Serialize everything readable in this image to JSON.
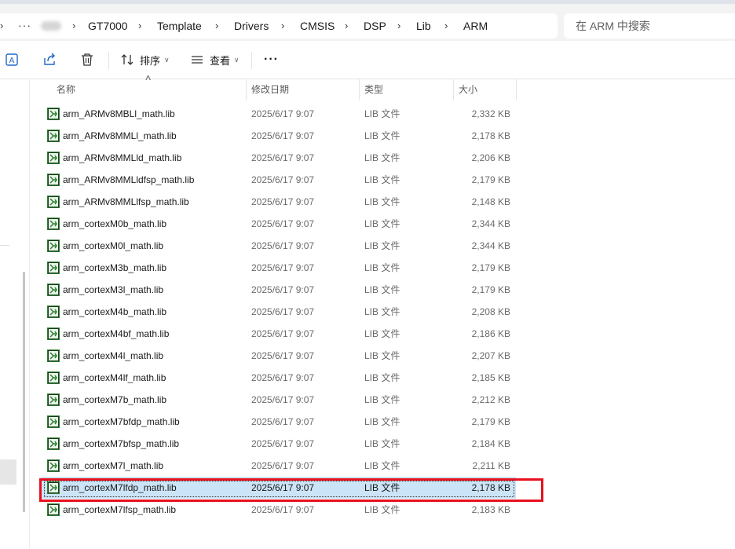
{
  "address_bar": {
    "breadcrumbs": [
      "GT7000",
      "Template",
      "Drivers",
      "CMSIS",
      "DSP",
      "Lib",
      "ARM"
    ],
    "more_label": "···",
    "search_placeholder": "在 ARM 中搜索"
  },
  "toolbar": {
    "sort_label": "排序",
    "view_label": "查看",
    "more_label": "···"
  },
  "columns": {
    "name": "名称",
    "date": "修改日期",
    "type": "类型",
    "size": "大小"
  },
  "files": [
    {
      "name": "arm_ARMv8MBLl_math.lib",
      "date": "2025/6/17 9:07",
      "type": "LIB 文件",
      "size": "2,332 KB"
    },
    {
      "name": "arm_ARMv8MMLl_math.lib",
      "date": "2025/6/17 9:07",
      "type": "LIB 文件",
      "size": "2,178 KB"
    },
    {
      "name": "arm_ARMv8MMLld_math.lib",
      "date": "2025/6/17 9:07",
      "type": "LIB 文件",
      "size": "2,206 KB"
    },
    {
      "name": "arm_ARMv8MMLldfsp_math.lib",
      "date": "2025/6/17 9:07",
      "type": "LIB 文件",
      "size": "2,179 KB"
    },
    {
      "name": "arm_ARMv8MMLlfsp_math.lib",
      "date": "2025/6/17 9:07",
      "type": "LIB 文件",
      "size": "2,148 KB"
    },
    {
      "name": "arm_cortexM0b_math.lib",
      "date": "2025/6/17 9:07",
      "type": "LIB 文件",
      "size": "2,344 KB"
    },
    {
      "name": "arm_cortexM0l_math.lib",
      "date": "2025/6/17 9:07",
      "type": "LIB 文件",
      "size": "2,344 KB"
    },
    {
      "name": "arm_cortexM3b_math.lib",
      "date": "2025/6/17 9:07",
      "type": "LIB 文件",
      "size": "2,179 KB"
    },
    {
      "name": "arm_cortexM3l_math.lib",
      "date": "2025/6/17 9:07",
      "type": "LIB 文件",
      "size": "2,179 KB"
    },
    {
      "name": "arm_cortexM4b_math.lib",
      "date": "2025/6/17 9:07",
      "type": "LIB 文件",
      "size": "2,208 KB"
    },
    {
      "name": "arm_cortexM4bf_math.lib",
      "date": "2025/6/17 9:07",
      "type": "LIB 文件",
      "size": "2,186 KB"
    },
    {
      "name": "arm_cortexM4l_math.lib",
      "date": "2025/6/17 9:07",
      "type": "LIB 文件",
      "size": "2,207 KB"
    },
    {
      "name": "arm_cortexM4lf_math.lib",
      "date": "2025/6/17 9:07",
      "type": "LIB 文件",
      "size": "2,185 KB"
    },
    {
      "name": "arm_cortexM7b_math.lib",
      "date": "2025/6/17 9:07",
      "type": "LIB 文件",
      "size": "2,212 KB"
    },
    {
      "name": "arm_cortexM7bfdp_math.lib",
      "date": "2025/6/17 9:07",
      "type": "LIB 文件",
      "size": "2,179 KB"
    },
    {
      "name": "arm_cortexM7bfsp_math.lib",
      "date": "2025/6/17 9:07",
      "type": "LIB 文件",
      "size": "2,184 KB"
    },
    {
      "name": "arm_cortexM7l_math.lib",
      "date": "2025/6/17 9:07",
      "type": "LIB 文件",
      "size": "2,211 KB"
    },
    {
      "name": "arm_cortexM7lfdp_math.lib",
      "date": "2025/6/17 9:07",
      "type": "LIB 文件",
      "size": "2,178 KB",
      "selected": true
    },
    {
      "name": "arm_cortexM7lfsp_math.lib",
      "date": "2025/6/17 9:07",
      "type": "LIB 文件",
      "size": "2,183 KB"
    }
  ],
  "colors": {
    "selection": "#cce4f7",
    "annotation_box": "#e8101d",
    "file_icon_green": "#2e7d32"
  }
}
